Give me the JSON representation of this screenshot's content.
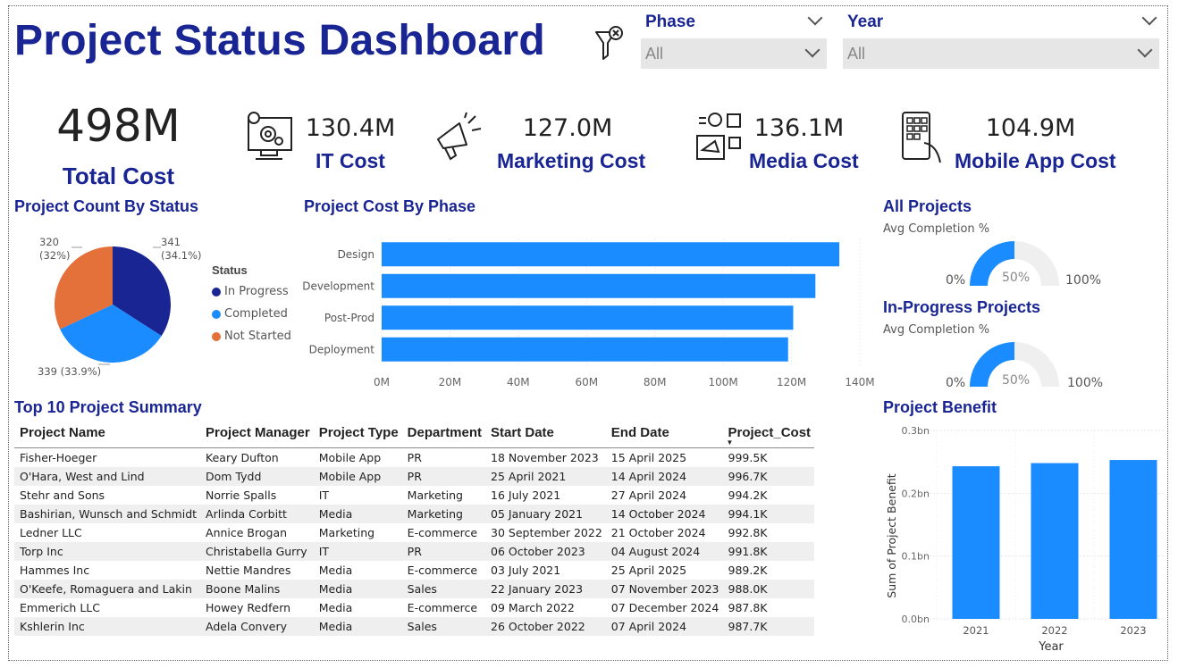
{
  "header": {
    "title": "Project Status Dashboard"
  },
  "filters": {
    "icon": "filter-clear-icon",
    "phase": {
      "label": "Phase",
      "value": "All"
    },
    "year": {
      "label": "Year",
      "value": "All"
    }
  },
  "kpis": {
    "total": {
      "value": "498M",
      "label": "Total Cost"
    },
    "items": [
      {
        "value": "130.4M",
        "label": "IT Cost",
        "icon": "computer-gear-icon"
      },
      {
        "value": "127.0M",
        "label": "Marketing Cost",
        "icon": "megaphone-icon"
      },
      {
        "value": "136.1M",
        "label": "Media Cost",
        "icon": "social-media-icon"
      },
      {
        "value": "104.9M",
        "label": "Mobile App Cost",
        "icon": "mobile-app-icon"
      }
    ]
  },
  "colors": {
    "navy": "#1a2594",
    "blue": "#1a8cff",
    "orange": "#e4703a",
    "gauge_bg": "#efefef"
  },
  "status_chart": {
    "title": "Project Count By Status",
    "legend_title": "Status",
    "labels": {
      "in_progress": "341\n(34.1%)",
      "not_started": "320\n(32%)",
      "completed": "339 (33.9%)"
    },
    "chart_data": {
      "type": "pie",
      "categories": [
        "In Progress",
        "Completed",
        "Not Started"
      ],
      "values": [
        341,
        339,
        320
      ],
      "percents": [
        34.1,
        33.9,
        32.0
      ]
    }
  },
  "phase_chart": {
    "title": "Project Cost By Phase",
    "ticks": [
      "0M",
      "20M",
      "40M",
      "60M",
      "80M",
      "100M",
      "120M",
      "140M"
    ],
    "chart_data": {
      "type": "bar",
      "orientation": "horizontal",
      "categories": [
        "Design",
        "Development",
        "Post-Prod",
        "Deployment"
      ],
      "values": [
        134,
        127,
        120.5,
        119
      ],
      "xlim": [
        0,
        140
      ]
    }
  },
  "gauges": [
    {
      "title": "All Projects",
      "subtitle": "Avg Completion %",
      "min": "0%",
      "max": "100%",
      "center": "50%",
      "value": 50
    },
    {
      "title": "In-Progress Projects",
      "subtitle": "Avg Completion %",
      "min": "0%",
      "max": "100%",
      "center": "50%",
      "value": 50
    }
  ],
  "summary": {
    "title": "Top 10 Project Summary",
    "columns": [
      "Project Name",
      "Project Manager",
      "Project Type",
      "Department",
      "Start Date",
      "End Date",
      "Project_Cost"
    ],
    "sort_column": "Project_Cost",
    "rows": [
      [
        "Fisher-Hoeger",
        "Keary Dufton",
        "Mobile App",
        "PR",
        "18 November 2023",
        "15 April 2025",
        "999.5K"
      ],
      [
        "O'Hara, West and Lind",
        "Dom Tydd",
        "Mobile App",
        "PR",
        "25 April 2021",
        "14 April 2024",
        "996.7K"
      ],
      [
        "Stehr and Sons",
        "Norrie Spalls",
        "IT",
        "Marketing",
        "16 July 2021",
        "27 April 2024",
        "994.2K"
      ],
      [
        "Bashirian, Wunsch and Schmidt",
        "Arlinda Corbitt",
        "Media",
        "Marketing",
        "05 January 2021",
        "14 October 2024",
        "994.1K"
      ],
      [
        "Ledner LLC",
        "Annice Brogan",
        "Marketing",
        "E-commerce",
        "30 September 2022",
        "21 October 2024",
        "992.8K"
      ],
      [
        "Torp Inc",
        "Christabella Gurry",
        "IT",
        "PR",
        "06 October 2023",
        "04 August 2024",
        "991.8K"
      ],
      [
        "Hammes Inc",
        "Nettie Mandres",
        "Media",
        "E-commerce",
        "03 July 2021",
        "25 April 2025",
        "989.2K"
      ],
      [
        "O'Keefe, Romaguera and Lakin",
        "Boone Malins",
        "Media",
        "Sales",
        "22 January 2023",
        "07 November 2023",
        "988.0K"
      ],
      [
        "Emmerich LLC",
        "Howey Redfern",
        "Media",
        "E-commerce",
        "09 March 2022",
        "07 December 2024",
        "987.8K"
      ],
      [
        "Kshlerin Inc",
        "Adela Convery",
        "Media",
        "Sales",
        "26 October 2022",
        "07 April 2024",
        "987.7K"
      ]
    ]
  },
  "benefit_chart": {
    "title": "Project Benefit",
    "ylabel": "Sum of Project Benefit",
    "xlabel": "Year",
    "yticks": [
      "0.0bn",
      "0.1bn",
      "0.2bn",
      "0.3bn"
    ],
    "chart_data": {
      "type": "bar",
      "categories": [
        "2021",
        "2022",
        "2023"
      ],
      "values": [
        0.243,
        0.248,
        0.253
      ],
      "ylim": [
        0,
        0.3
      ],
      "ylabel": "Sum of Project Benefit",
      "xlabel": "Year"
    }
  }
}
